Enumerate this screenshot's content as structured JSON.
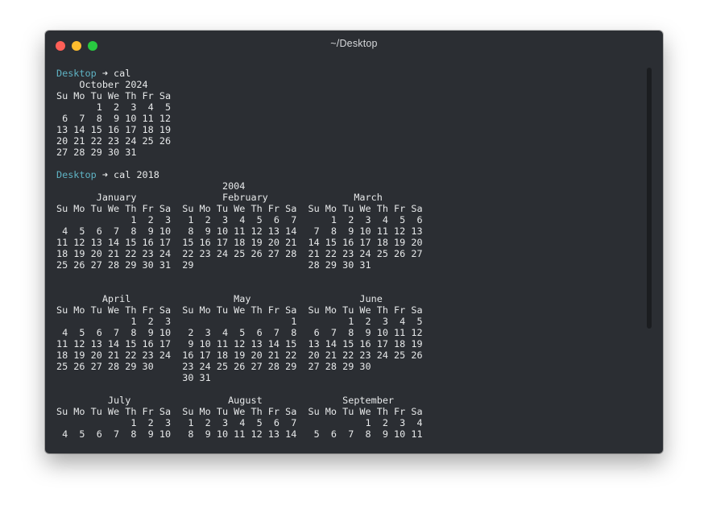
{
  "window": {
    "title": "~/Desktop",
    "colors": {
      "background": "#2b2e33",
      "text": "#e7e9ea",
      "prompt_dir": "#5fb3c4",
      "close": "#fe5f57",
      "minimize": "#febc2e",
      "zoom": "#28c840"
    }
  },
  "session": {
    "prompt_dir": "Desktop",
    "prompt_arrow": "➜",
    "commands": [
      " cal",
      " cal 2018"
    ]
  },
  "output": {
    "cal_month": [
      "    October 2024",
      "Su Mo Tu We Th Fr Sa",
      "       1  2  3  4  5",
      " 6  7  8  9 10 11 12",
      "13 14 15 16 17 18 19",
      "20 21 22 23 24 25 26",
      "27 28 29 30 31"
    ],
    "cal_year": [
      "                             2004",
      "       January               February               March",
      "Su Mo Tu We Th Fr Sa  Su Mo Tu We Th Fr Sa  Su Mo Tu We Th Fr Sa",
      "             1  2  3   1  2  3  4  5  6  7      1  2  3  4  5  6",
      " 4  5  6  7  8  9 10   8  9 10 11 12 13 14   7  8  9 10 11 12 13",
      "11 12 13 14 15 16 17  15 16 17 18 19 20 21  14 15 16 17 18 19 20",
      "18 19 20 21 22 23 24  22 23 24 25 26 27 28  21 22 23 24 25 26 27",
      "25 26 27 28 29 30 31  29                    28 29 30 31",
      "",
      "",
      "        April                  May                   June",
      "Su Mo Tu We Th Fr Sa  Su Mo Tu We Th Fr Sa  Su Mo Tu We Th Fr Sa",
      "             1  2  3                     1         1  2  3  4  5",
      " 4  5  6  7  8  9 10   2  3  4  5  6  7  8   6  7  8  9 10 11 12",
      "11 12 13 14 15 16 17   9 10 11 12 13 14 15  13 14 15 16 17 18 19",
      "18 19 20 21 22 23 24  16 17 18 19 20 21 22  20 21 22 23 24 25 26",
      "25 26 27 28 29 30     23 24 25 26 27 28 29  27 28 29 30",
      "                      30 31",
      "",
      "         July                 August              September",
      "Su Mo Tu We Th Fr Sa  Su Mo Tu We Th Fr Sa  Su Mo Tu We Th Fr Sa",
      "             1  2  3   1  2  3  4  5  6  7            1  2  3  4",
      " 4  5  6  7  8  9 10   8  9 10 11 12 13 14   5  6  7  8  9 10 11"
    ]
  }
}
